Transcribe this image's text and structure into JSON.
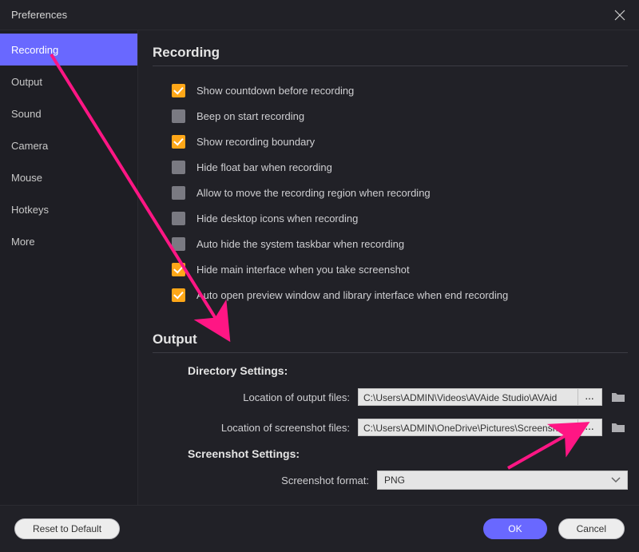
{
  "window": {
    "title": "Preferences"
  },
  "sidebar": {
    "items": [
      {
        "label": "Recording",
        "active": true
      },
      {
        "label": "Output"
      },
      {
        "label": "Sound"
      },
      {
        "label": "Camera"
      },
      {
        "label": "Mouse"
      },
      {
        "label": "Hotkeys"
      },
      {
        "label": "More"
      }
    ]
  },
  "recording": {
    "heading": "Recording",
    "options": [
      {
        "label": "Show countdown before recording",
        "checked": true
      },
      {
        "label": "Beep on start recording",
        "checked": false
      },
      {
        "label": "Show recording boundary",
        "checked": true
      },
      {
        "label": "Hide float bar when recording",
        "checked": false
      },
      {
        "label": "Allow to move the recording region when recording",
        "checked": false
      },
      {
        "label": "Hide desktop icons when recording",
        "checked": false
      },
      {
        "label": "Auto hide the system taskbar when recording",
        "checked": false
      },
      {
        "label": "Hide main interface when you take screenshot",
        "checked": true
      },
      {
        "label": "Auto open preview window and library interface when end recording",
        "checked": true
      }
    ]
  },
  "output": {
    "heading": "Output",
    "directory": {
      "heading": "Directory Settings:",
      "rows": [
        {
          "label": "Location of output files:",
          "value": "C:\\Users\\ADMIN\\Videos\\AVAide Studio\\AVAid"
        },
        {
          "label": "Location of screenshot files:",
          "value": "C:\\Users\\ADMIN\\OneDrive\\Pictures\\Screensho"
        }
      ],
      "browse_label": "..."
    },
    "screenshot": {
      "heading": "Screenshot Settings:",
      "format_label": "Screenshot format:",
      "format_value": "PNG"
    }
  },
  "buttons": {
    "reset": "Reset to Default",
    "ok": "OK",
    "cancel": "Cancel"
  }
}
